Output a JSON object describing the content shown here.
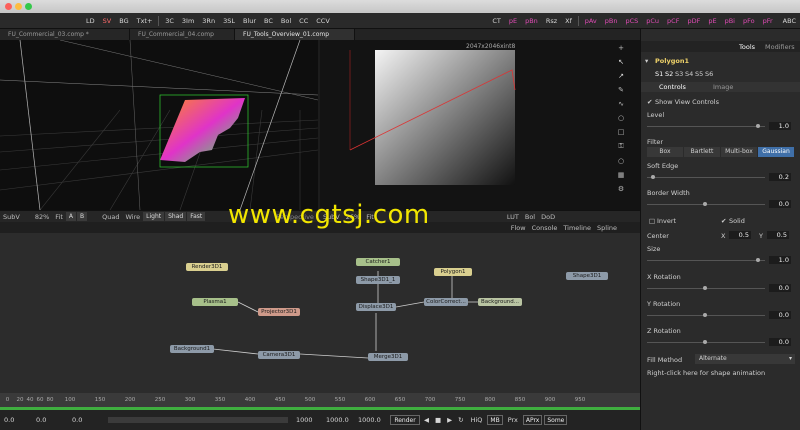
{
  "toolbar": {
    "items": [
      "LD",
      "SV",
      "BG",
      "Txt+",
      "3C",
      "3Im",
      "3Rn",
      "3SL",
      "Blur",
      "BC",
      "Bol",
      "CC",
      "CCV"
    ],
    "items_right": [
      "CT",
      "pE",
      "pBn",
      "Rsz",
      "Xf",
      "pAv",
      "pBn",
      "pCS",
      "pCu",
      "pCF",
      "pDF",
      "pE",
      "pBi",
      "pFo",
      "pFr"
    ],
    "right_label": "ABC"
  },
  "tabs": [
    "FU_Commercial_03.comp *",
    "FU_Commercial_04.comp",
    "FU_Tools_Overview_01.comp"
  ],
  "viewer_right": {
    "resolution": "2047x2046xint8"
  },
  "viewerbar": {
    "left": [
      "SubV",
      "82%",
      "Fit",
      "A",
      "B",
      "Quad",
      "Wire",
      "Light",
      "Shad",
      "Fast"
    ],
    "mid": [
      "Perspective",
      "SubV",
      "26%",
      "Fit",
      "LUT",
      "Bol",
      "DoD"
    ],
    "nodes_label": "Node"
  },
  "nodebar": [
    "Flow",
    "Console",
    "Timeline",
    "Spline"
  ],
  "nodes": {
    "render3d1": "Render3D1",
    "catcher1": "Catcher1",
    "shape3d1a": "Shape3D1_1",
    "polygon1": "Polygon1",
    "shape3d1": "Shape3D1",
    "plasma1": "Plasma1",
    "projector": "Projector3D1",
    "displace": "Displace3D1",
    "colorcorrect": "ColorCorrect...",
    "background2": "Background...",
    "background1": "Background1",
    "camera": "Camera3D1",
    "merge": "Merge3D1"
  },
  "ruler": {
    "ticks": [
      "0",
      "20",
      "40",
      "60",
      "80",
      "100",
      "150",
      "200",
      "250",
      "300",
      "350",
      "400",
      "450",
      "500",
      "550",
      "600",
      "650",
      "700",
      "750",
      "800",
      "850",
      "900",
      "950"
    ]
  },
  "transport": {
    "cur": "0.0",
    "start": "0.0",
    "render_start": "0.0",
    "end_small": "1000",
    "end": "1000.0",
    "end2": "1000.0",
    "render": "Render",
    "hiq": "HiQ",
    "mb": "MB",
    "prx": "Prx",
    "aprx": "APrx",
    "some": "Some"
  },
  "panel": {
    "tab_tools": "Tools",
    "tab_modifiers": "Modifiers",
    "tool_name": "Polygon1",
    "sub_tabs": [
      "S1",
      "S2",
      "S3",
      "S4",
      "S5",
      "S6"
    ],
    "controls": "Controls",
    "image": "Image",
    "show_view": "Show View Controls",
    "level": "Level",
    "level_val": "1.0",
    "filter": "Filter",
    "filters": [
      "Box",
      "Bartlett",
      "Multi-box",
      "Gaussian"
    ],
    "soft_edge": "Soft Edge",
    "soft_val": "0.2",
    "border_width": "Border Width",
    "border_val": "0.0",
    "invert": "Invert",
    "solid": "Solid",
    "center": "Center",
    "x": "X",
    "x_val": "0.5",
    "y": "Y",
    "y_val": "0.5",
    "size": "Size",
    "size_val": "1.0",
    "xrot": "X Rotation",
    "xrot_val": "0.0",
    "yrot": "Y Rotation",
    "yrot_val": "0.0",
    "zrot": "Z Rotation",
    "zrot_val": "0.0",
    "fill_method": "Fill Method",
    "fill_val": "Alternate",
    "hint": "Right-click here for shape animation"
  },
  "watermark": "www.cgtsj.com"
}
